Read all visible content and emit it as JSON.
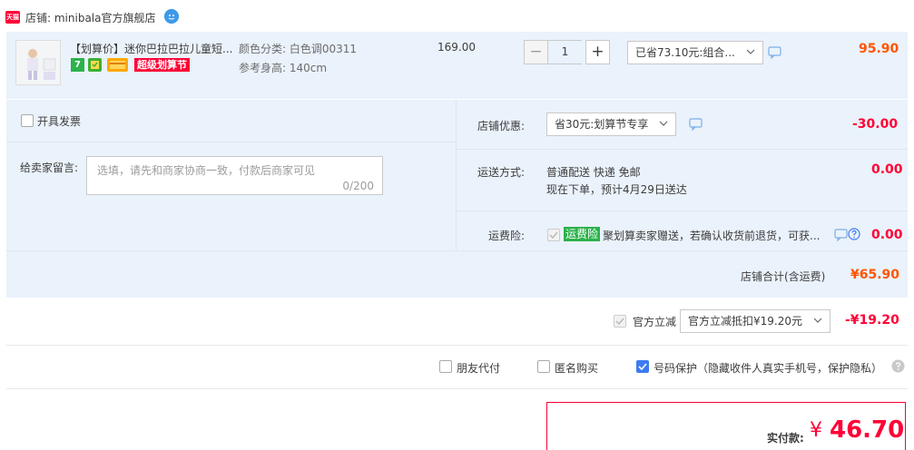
{
  "shop": {
    "badge_text": "天猫",
    "label": "店铺: minibala官方旗舰店"
  },
  "item": {
    "title": "【划算价】迷你巴拉巴拉儿童短...",
    "sku_color": "颜色分类: 白色调00311",
    "sku_height": "参考身高: 140cm",
    "price": "169.00",
    "quantity": "1",
    "promo_select": "已省73.10元:组合...",
    "subtotal": "95.90",
    "badge_seven": "7",
    "badge_promo": "超级划算节"
  },
  "invoice": {
    "label": "开具发票"
  },
  "message": {
    "label": "给卖家留言:",
    "placeholder": "选填，请先和商家协商一致，付款后商家可见",
    "counter": "0/200"
  },
  "shop_discount": {
    "label": "店铺优惠:",
    "select": "省30元:划算节专享",
    "amount": "-30.00"
  },
  "delivery": {
    "label": "运送方式:",
    "method": "普通配送 快递 免邮",
    "eta": "现在下单，预计4月29日送达",
    "amount": "0.00"
  },
  "insurance": {
    "label": "运费险:",
    "tag": "运费险",
    "text": "聚划算卖家赠送，若确认收货前退货，可获...",
    "amount": "0.00"
  },
  "shop_total": {
    "label": "店铺合计(含运费)",
    "amount": "¥65.90"
  },
  "official_discount": {
    "label": "官方立减",
    "select": "官方立减抵扣¥19.20元",
    "amount": "-¥19.20"
  },
  "options": {
    "friend_pay": "朋友代付",
    "anonymous": "匿名购买",
    "number_protect": "号码保护（隐藏收件人真实手机号，保护隐私）"
  },
  "payment": {
    "label": "实付款:",
    "currency": "¥",
    "amount": "46.70"
  },
  "colors": {
    "accent_red": "#ff0036",
    "accent_orange": "#ff5500",
    "panel_blue": "#eaf2fb",
    "checkbox_blue": "#3e7bf2"
  }
}
